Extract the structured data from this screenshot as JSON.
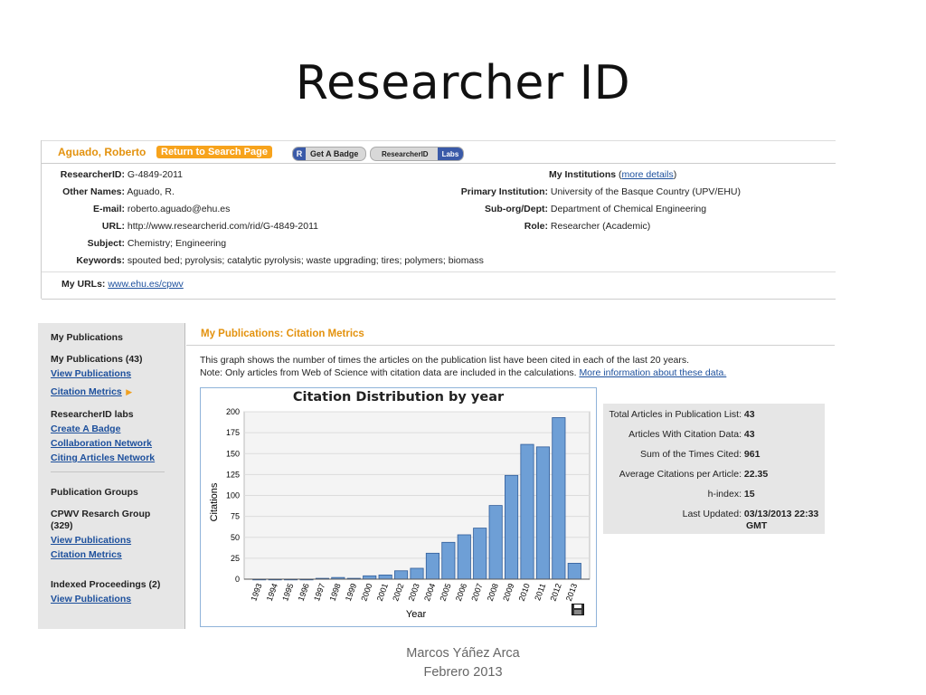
{
  "slide": {
    "title": "Researcher ID",
    "footer_line1": "Marcos Yáñez Arca",
    "footer_line2": "Febrero 2013"
  },
  "profile": {
    "name": "Aguado, Roberto",
    "return_button": "Return to Search Page",
    "badge_r": "R",
    "badge_label": "Get A Badge",
    "rid_label": "ResearcherID",
    "labs_label": "Labs",
    "left_fields": [
      {
        "label": "ResearcherID:",
        "value": "G-4849-2011"
      },
      {
        "label": "Other Names:",
        "value": "Aguado, R."
      },
      {
        "label": "E-mail:",
        "value": "roberto.aguado@ehu.es"
      },
      {
        "label": "URL:",
        "value": "http://www.researcherid.com/rid/G-4849-2011"
      },
      {
        "label": "Subject:",
        "value": "Chemistry; Engineering"
      },
      {
        "label": "Keywords:",
        "value": "spouted bed; pyrolysis; catalytic pyrolysis; waste upgrading; tires; polymers; biomass"
      }
    ],
    "my_institutions_label": "My Institutions",
    "more_details": "more details",
    "right_fields": [
      {
        "label": "Primary Institution:",
        "value": "University of the Basque Country (UPV/EHU)"
      },
      {
        "label": "Sub-org/Dept:",
        "value": "Department of Chemical Engineering"
      },
      {
        "label": "Role:",
        "value": "Researcher (Academic)"
      }
    ],
    "my_urls_label": "My URLs:",
    "my_urls_value": "www.ehu.es/cpwv"
  },
  "sidebar": {
    "my_publications": "My Publications",
    "my_publications_count": "My Publications (43)",
    "view_publications": "View Publications",
    "citation_metrics": "Citation Metrics",
    "rid_labs": "ResearcherID labs",
    "create_badge": "Create A Badge",
    "collab_network": "Collaboration Network",
    "citing_network": "Citing Articles Network",
    "pub_groups": "Publication Groups",
    "cpwv_group_1": "CPWV Resarch Group",
    "cpwv_group_2": "(329)",
    "view_publications_2": "View Publications",
    "citation_metrics_2": "Citation Metrics",
    "indexed_proceedings": "Indexed Proceedings (2)",
    "view_publications_3": "View Publications"
  },
  "main": {
    "heading": "My Publications: Citation Metrics",
    "desc_line1": "This graph shows the number of times the articles on the publication list have been cited in each of the last 20 years.",
    "desc_line2": "Note: Only articles from Web of Science with citation data are included in the calculations.",
    "more_info_link": "More information about these data."
  },
  "stats": [
    {
      "label": "Total Articles in Publication List:",
      "value": "43"
    },
    {
      "label": "Articles With Citation Data:",
      "value": "43"
    },
    {
      "label": "Sum of the Times Cited:",
      "value": "961"
    },
    {
      "label": "Average Citations per Article:",
      "value": "22.35"
    },
    {
      "label": "h-index:",
      "value": "15"
    },
    {
      "label": "Last Updated:",
      "value": "03/13/2013 22:33",
      "value2": "GMT"
    }
  ],
  "colors": {
    "accent": "#e3920e",
    "link": "#1c4f9c",
    "bar": "#6e9fd6",
    "bar_edge": "#2f5c99"
  },
  "icons": {
    "save": "floppy-disk-icon",
    "arrow": "orange-triangle-right-icon"
  },
  "chart_data": {
    "type": "bar",
    "title": "Citation Distribution by year",
    "xlabel": "Year",
    "ylabel": "Citations",
    "ylim": [
      0,
      200
    ],
    "yticks": [
      0,
      25,
      50,
      75,
      100,
      125,
      150,
      175,
      200
    ],
    "grid": true,
    "categories": [
      "1993",
      "1994",
      "1995",
      "1996",
      "1997",
      "1998",
      "1999",
      "2000",
      "2001",
      "2002",
      "2003",
      "2004",
      "2005",
      "2006",
      "2007",
      "2008",
      "2009",
      "2010",
      "2011",
      "2012",
      "2013"
    ],
    "values": [
      0,
      0,
      0,
      0,
      1,
      2,
      1,
      4,
      5,
      10,
      13,
      31,
      44,
      53,
      61,
      88,
      124,
      161,
      158,
      193,
      19
    ]
  }
}
